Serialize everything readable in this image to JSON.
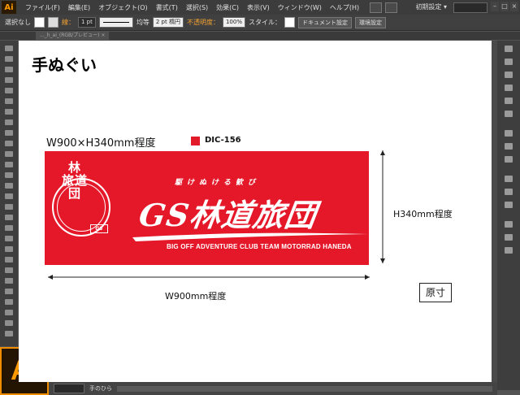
{
  "app": {
    "icon_label": "Ai",
    "logo_label": "Ai"
  },
  "menu": [
    "ファイル(F)",
    "編集(E)",
    "オブジェクト(O)",
    "書式(T)",
    "選択(S)",
    "効果(C)",
    "表示(V)",
    "ウィンドウ(W)",
    "ヘルプ(H)"
  ],
  "workspace": {
    "label": "初期設定 ▾"
  },
  "control_bar": {
    "selection": "選択なし",
    "stroke_label": "線：",
    "stroke_weight": "1 pt",
    "profile": "均等",
    "brush": "2 pt 楕円",
    "opacity_label": "不透明度：",
    "opacity": "100%",
    "style_label": "スタイル：",
    "doc_setup": "ドキュメント設定",
    "prefs": "環境設定"
  },
  "document_tab": "..._h_ai_(RGB/プレビュー) ×",
  "artboard": {
    "title": "手ぬぐい",
    "size_label": "W900×H340mm程度",
    "color_code": "DIC-156",
    "width_label": "W900mm程度",
    "height_label": "H340mm程度",
    "actual_size": "原寸",
    "colors": {
      "towel": "#e5182a",
      "chip": "#e11b2a"
    }
  },
  "design": {
    "seal_kanji_top": "林",
    "seal_kanji_mid": "旅道",
    "seal_kanji_bot": "団",
    "seal_mark": "GS",
    "tagline": "駆けぬける歓び",
    "brand": "GS林道旅団",
    "club": "BIG OFF ADVENTURE CLUB  TEAM MOTORRAD HANEDA"
  },
  "status": {
    "tool": "手のひら"
  }
}
